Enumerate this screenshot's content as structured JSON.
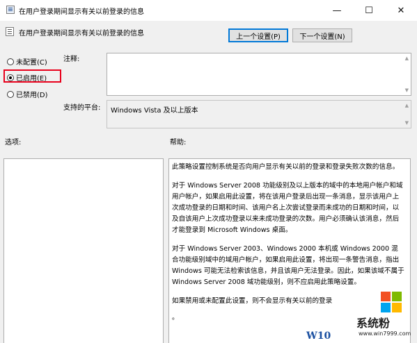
{
  "window": {
    "title": "在用户登录期间显示有关以前登录的信息",
    "minimize_glyph": "—",
    "maximize_glyph": "☐",
    "close_glyph": "✕"
  },
  "header": {
    "policy_title": "在用户登录期间显示有关以前登录的信息",
    "prev_button": "上一个设置(P)",
    "next_button": "下一个设置(N)"
  },
  "state": {
    "options": [
      {
        "label": "未配置(C)",
        "checked": false
      },
      {
        "label": "已启用(E)",
        "checked": true
      },
      {
        "label": "已禁用(D)",
        "checked": false
      }
    ],
    "highlight_color": "#e8001c"
  },
  "comment": {
    "label": "注释:",
    "value": ""
  },
  "platform": {
    "label": "支持的平台:",
    "value": "Windows Vista 及以上版本"
  },
  "options_section": {
    "label": "选项:"
  },
  "help_section": {
    "label": "帮助:",
    "paragraphs": [
      "此策略设置控制系统是否向用户显示有关以前的登录和登录失败次数的信息。",
      "对于 Windows Server 2008 功能级别及以上版本的域中的本地用户帐户和域用户帐户，如果启用此设置，将在该用户登录后出现一条消息，显示该用户上次成功登录的日期和时间、该用户名上次尝试登录而未成功的日期和时间，以及自该用户上次成功登录以来未成功登录的次数。用户必须确认该消息，然后才能登录到 Microsoft Windows 桌面。",
      "对于 Windows Server 2003、Windows 2000 本机或 Windows 2000 混合功能级别域中的域用户帐户，如果启用此设置，将出现一条警告消息，指出 Windows 可能无法检索该信息，并且该用户无法登录。因此，如果该域不属于 Windows Server 2008 域功能级别，则不应启用此策略设置。",
      "如果禁用或未配置此设置，则不会显示有关以前的登录",
      "。"
    ]
  },
  "watermark": {
    "site_name": "系统粉",
    "url": "www.win7999.com",
    "os_mark": "W10",
    "logo_colors": [
      "#f25022",
      "#7fba00",
      "#00a4ef",
      "#ffb900"
    ]
  }
}
